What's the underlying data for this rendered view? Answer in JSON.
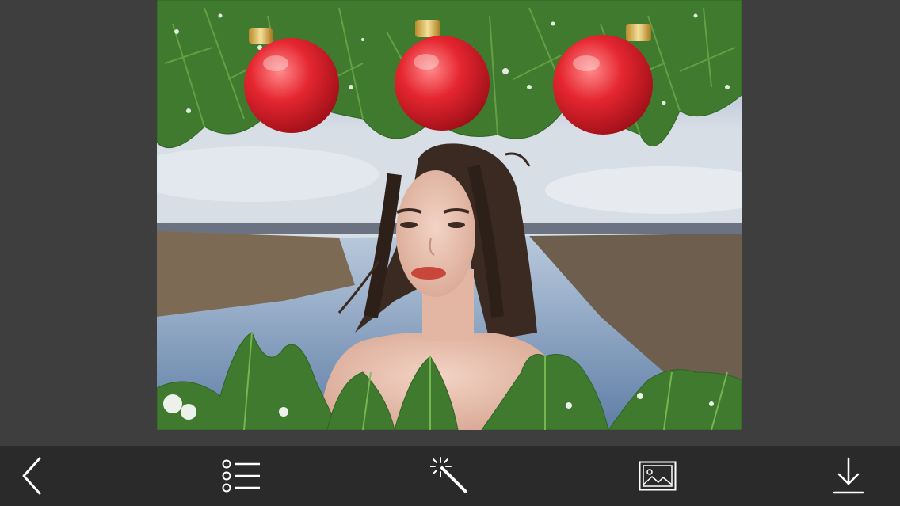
{
  "editor": {
    "frame_name": "christmas-frame",
    "colors": {
      "background": "#3e3e3e",
      "toolbar": "#2a2a2a",
      "icon": "#ffffff",
      "ornament": "#e0202c"
    }
  },
  "toolbar": {
    "items": [
      {
        "name": "back-button",
        "icon": "chevron-left-icon"
      },
      {
        "name": "frames-list-button",
        "icon": "list-icon"
      },
      {
        "name": "effects-button",
        "icon": "magic-wand-icon"
      },
      {
        "name": "gallery-button",
        "icon": "image-icon"
      },
      {
        "name": "download-button",
        "icon": "download-icon"
      }
    ]
  }
}
